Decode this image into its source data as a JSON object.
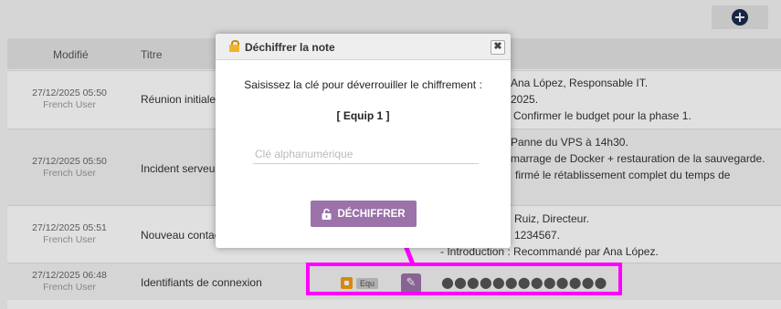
{
  "toolbar": {
    "add_icon": "plus-circle-icon"
  },
  "table": {
    "headers": {
      "modified": "Modifié",
      "title": "Titre"
    },
    "rows": [
      {
        "date": "27/12/2025 05:50",
        "user": "French User",
        "title": "Réunion initiale",
        "lines": [
          "Ana López, Responsable IT.",
          "2025.",
          "Confirmer le budget pour la phase 1."
        ]
      },
      {
        "date": "27/12/2025 05:50",
        "user": "French User",
        "title": "Incident serveur",
        "lines": [
          "Panne du VPS à 14h30.",
          "marrage de Docker + restauration de la sauvegarde.",
          "firmé le rétablissement complet du temps de"
        ]
      },
      {
        "date": "27/12/2025 05:51",
        "user": "French User",
        "title": "Nouveau contact",
        "lines": [
          "Ruiz, Directeur.",
          "1234567.",
          "- Introduction : Recommandé par Ana López."
        ]
      },
      {
        "date": "27/12/2025 06:48",
        "user": "French User",
        "title": "Identifiants de connexion",
        "badge": "Equ",
        "masked": "●●●●●●●●●●●●●"
      }
    ]
  },
  "modal": {
    "title": "Déchiffrer la note",
    "close": "✖",
    "message": "Saisissez la clé pour déverrouiller le chiffrement :",
    "key_name": "[ Equip 1 ]",
    "placeholder": "Clé alphanumérique",
    "button": "DÉCHIFFRER"
  },
  "colors": {
    "accent": "#9b72aa",
    "highlight": "#ff00ff",
    "lock": "#f39c12"
  }
}
